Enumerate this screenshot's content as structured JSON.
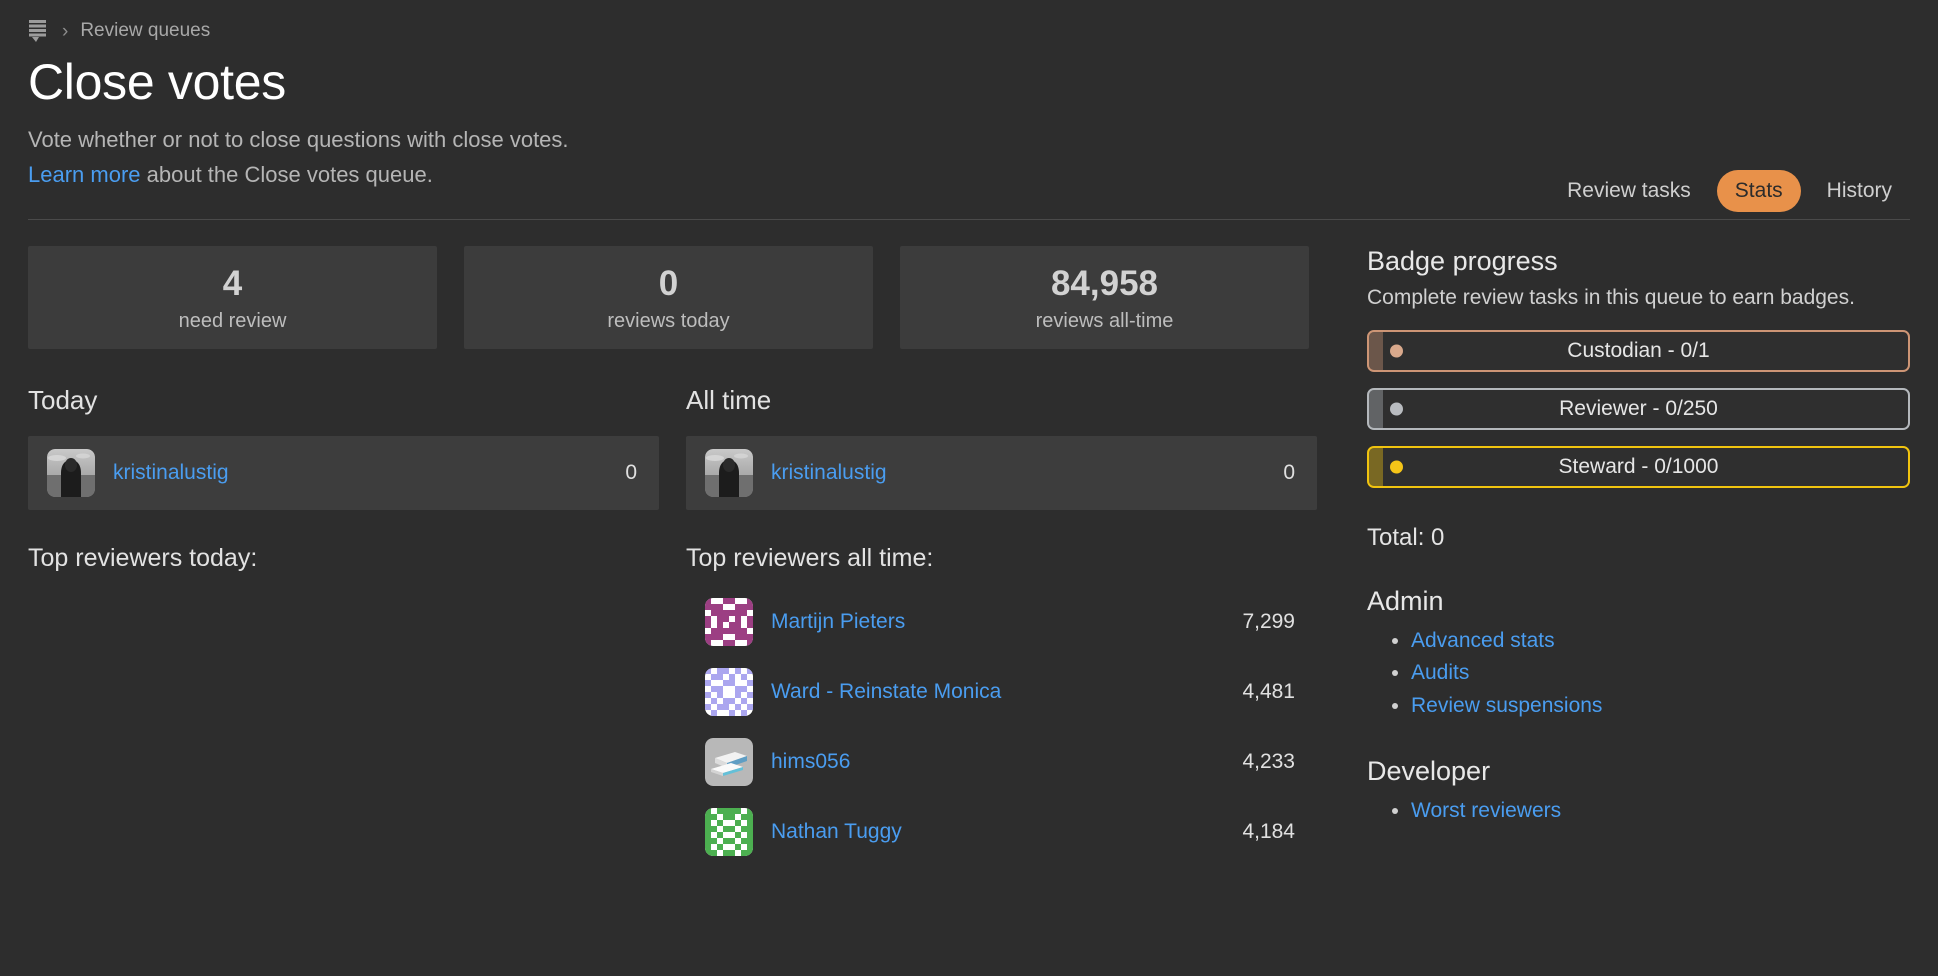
{
  "breadcrumb": {
    "icon": "review-queue-icon",
    "separator": "›",
    "link_label": "Review queues"
  },
  "header": {
    "title": "Close votes",
    "subtitle": "Vote whether or not to close questions with close votes.",
    "learn_more_label": "Learn more",
    "learn_more_suffix": " about the Close votes queue."
  },
  "nav": {
    "tabs": [
      {
        "label": "Review tasks",
        "active": false
      },
      {
        "label": "Stats",
        "active": true
      },
      {
        "label": "History",
        "active": false
      }
    ],
    "active_color": "#e8914a"
  },
  "stats": [
    {
      "value": "4",
      "label": "need review"
    },
    {
      "value": "0",
      "label": "reviews today"
    },
    {
      "value": "84,958",
      "label": "reviews all-time"
    }
  ],
  "today": {
    "heading": "Today",
    "current_user": {
      "name": "kristinalustig",
      "count": "0",
      "avatar": "photo-avatar"
    },
    "top_heading": "Top reviewers today:",
    "reviewers": []
  },
  "all_time": {
    "heading": "All time",
    "current_user": {
      "name": "kristinalustig",
      "count": "0",
      "avatar": "photo-avatar"
    },
    "top_heading": "Top reviewers all time:",
    "reviewers": [
      {
        "name": "Martijn Pieters",
        "count": "7,299",
        "avatar": "identicon-magenta"
      },
      {
        "name": "Ward - Reinstate Monica",
        "count": "4,481",
        "avatar": "identicon-periwinkle"
      },
      {
        "name": "hims056",
        "count": "4,233",
        "avatar": "photo-books"
      },
      {
        "name": "Nathan Tuggy",
        "count": "4,184",
        "avatar": "identicon-green"
      }
    ]
  },
  "sidebar": {
    "badge_progress": {
      "title": "Badge progress",
      "description": "Complete review tasks in this queue to earn badges.",
      "badges": [
        {
          "label": "Custodian - 0/1",
          "color": "#cd9575",
          "tier": "bronze"
        },
        {
          "label": "Reviewer - 0/250",
          "color": "#b4b8bc",
          "tier": "silver"
        },
        {
          "label": "Steward - 0/1000",
          "color": "#f1c40f",
          "tier": "gold"
        }
      ]
    },
    "total_label": "Total: 0",
    "admin": {
      "heading": "Admin",
      "links": [
        "Advanced stats",
        "Audits",
        "Review suspensions"
      ]
    },
    "developer": {
      "heading": "Developer",
      "links": [
        "Worst reviewers"
      ]
    }
  },
  "colors": {
    "page_bg": "#2d2d2d",
    "card_bg": "#3c3c3c",
    "link": "#4a9df0",
    "accent": "#e8914a"
  }
}
